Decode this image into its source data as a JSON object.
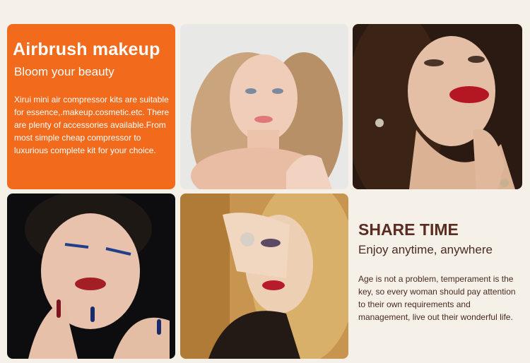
{
  "promo": {
    "title": "Airbrush makeup",
    "subtitle": "Bloom your beauty",
    "body": "Xirui mini air compressor kits are suitable for essence,.makeup.cosmetic.etc. There are plenty of accessories available.From most simple  cheap compressor to luxurious complete kit for your choice.",
    "color": "#f26a1b"
  },
  "share": {
    "title": "SHARE TIME",
    "subtitle": "Enjoy anytime, anywhere",
    "body": "Age is not a problem, temperament is the key, so every woman should pay attention to their own requirements and management, live out their wonderful life.",
    "title_color": "#5a2d22"
  },
  "background_color": "#f5f1e8"
}
